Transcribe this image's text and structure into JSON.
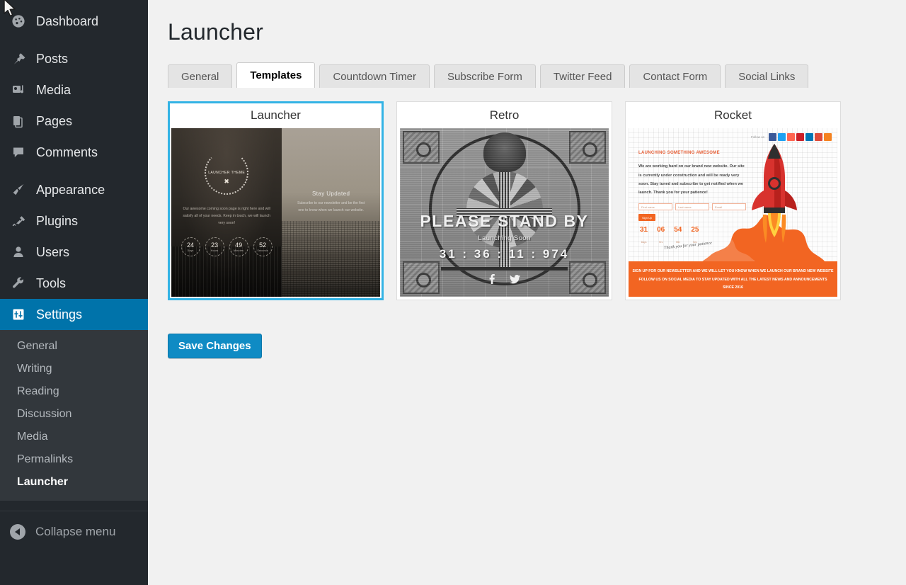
{
  "sidebar": {
    "items": [
      {
        "label": "Dashboard",
        "icon": "dashboard-icon"
      },
      {
        "label": "Posts",
        "icon": "pin-icon"
      },
      {
        "label": "Media",
        "icon": "media-icon"
      },
      {
        "label": "Pages",
        "icon": "pages-icon"
      },
      {
        "label": "Comments",
        "icon": "comment-icon"
      },
      {
        "label": "Appearance",
        "icon": "brush-icon"
      },
      {
        "label": "Plugins",
        "icon": "plug-icon"
      },
      {
        "label": "Users",
        "icon": "user-icon"
      },
      {
        "label": "Tools",
        "icon": "wrench-icon"
      },
      {
        "label": "Settings",
        "icon": "settings-icon"
      }
    ],
    "submenu": [
      {
        "label": "General"
      },
      {
        "label": "Writing"
      },
      {
        "label": "Reading"
      },
      {
        "label": "Discussion"
      },
      {
        "label": "Media"
      },
      {
        "label": "Permalinks"
      },
      {
        "label": "Launcher"
      }
    ],
    "collapse_label": "Collapse menu",
    "active_item": "Settings",
    "active_submenu": "Launcher",
    "accent_color": "#0073aa",
    "background_color": "#23282d"
  },
  "main": {
    "page_title": "Launcher",
    "tabs": [
      {
        "label": "General"
      },
      {
        "label": "Templates"
      },
      {
        "label": "Countdown Timer"
      },
      {
        "label": "Subscribe Form"
      },
      {
        "label": "Twitter Feed"
      },
      {
        "label": "Contact Form"
      },
      {
        "label": "Social Links"
      }
    ],
    "active_tab": "Templates",
    "save_label": "Save Changes",
    "save_color": "#0f8bc4",
    "selected_border_color": "#33b3e5"
  },
  "templates": {
    "selected": "Launcher",
    "cards": [
      {
        "title": "Launcher",
        "selected": true,
        "preview": {
          "brand": "Launcher Theme",
          "tagline": "Our awesome coming soon page is right here and will satisfy all of your needs. Keep in touch, we will launch very soon!",
          "counters": [
            {
              "value": "24",
              "label": "Days"
            },
            {
              "value": "23",
              "label": "Hours"
            },
            {
              "value": "49",
              "label": "Minutes"
            },
            {
              "value": "52",
              "label": "Seconds"
            }
          ],
          "right_heading": "Stay Updated",
          "right_subtext": "Subscribe to our newsletter and be the first one to know when we launch our website."
        }
      },
      {
        "title": "Retro",
        "selected": false,
        "preview": {
          "standby": "PLEASE STAND BY",
          "soon": "Launching Soon",
          "countdown": "31 : 36 : 11 : 974",
          "social": [
            "facebook-icon",
            "twitter-icon"
          ]
        }
      },
      {
        "title": "Rocket",
        "selected": false,
        "preview": {
          "follow_label": "Follow us",
          "heading": "LAUNCHING SOMETHING AWESOME",
          "body": "We are working hard on our brand new website. Our site is currently under construction and will be ready very soon. Stay tuned and subscribe to get notified when we launch. Thank you for your patience!",
          "form_fields": [
            "First name",
            "Last name",
            "Email"
          ],
          "form_button": "Sign Up",
          "counters": [
            {
              "value": "31",
              "label": "Days"
            },
            {
              "value": "06",
              "label": "Hrs"
            },
            {
              "value": "54",
              "label": "Min"
            },
            {
              "value": "25",
              "label": "Sec"
            }
          ],
          "signature": "Thank you for your patience",
          "footer_line1": "SIGN UP FOR OUR NEWSLETTER AND WE WILL LET YOU KNOW WHEN WE LAUNCH OUR BRAND NEW WEBSITE",
          "footer_line2": "FOLLOW US ON SOCIAL MEDIA TO STAY UPDATED WITH ALL THE LATEST NEWS AND ANNOUNCEMENTS",
          "footer_line3": "SINCE 2016",
          "accent_color": "#f26522",
          "social_icon_colors": [
            "#3b5998",
            "#1da1f2",
            "#ff6550",
            "#cb2027",
            "#0077b5",
            "#dd4b39",
            "#f58220"
          ]
        }
      }
    ]
  }
}
